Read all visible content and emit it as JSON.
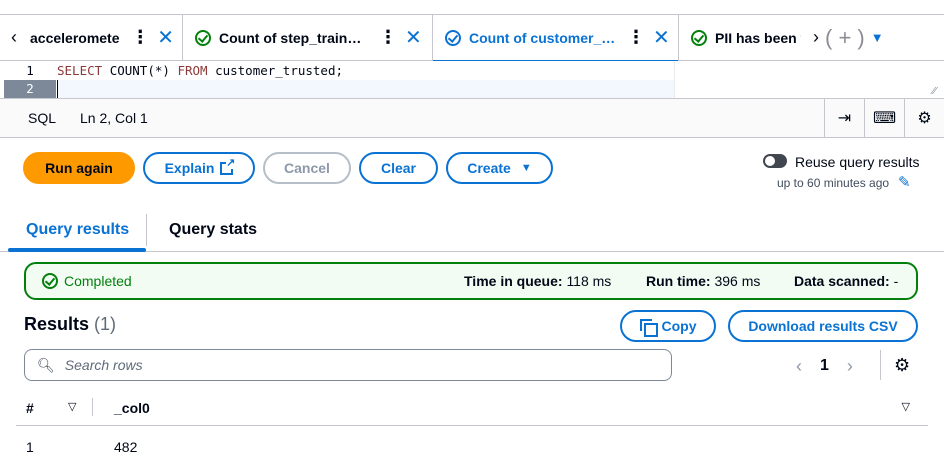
{
  "tabs": [
    {
      "label": "acceleromete",
      "status": "none",
      "active": false
    },
    {
      "label": "Count of step_trainer_trusted",
      "status": "completed",
      "active": false
    },
    {
      "label": "Count of customer_trusted",
      "status": "completed",
      "active": true
    },
    {
      "label": "PII has been filtered",
      "status": "completed",
      "active": false
    }
  ],
  "editor": {
    "line_numbers": [
      "1",
      "2"
    ],
    "line1": {
      "kw1": "SELECT",
      "fn": "COUNT",
      "args": "(*)",
      "kw2": "FROM",
      "rest": "customer_trusted;"
    }
  },
  "statusbar": {
    "language": "SQL",
    "cursor": "Ln 2, Col 1"
  },
  "actions": {
    "run_again": "Run again",
    "explain": "Explain",
    "cancel": "Cancel",
    "clear": "Clear",
    "create": "Create",
    "reuse_label": "Reuse query results",
    "reuse_sub": "up to 60 minutes ago"
  },
  "result_tabs": {
    "results": "Query results",
    "stats": "Query stats"
  },
  "status": {
    "label": "Completed",
    "time_in_queue_label": "Time in queue:",
    "time_in_queue": "118 ms",
    "run_time_label": "Run time:",
    "run_time": "396 ms",
    "data_scanned_label": "Data scanned:",
    "data_scanned": "-"
  },
  "results": {
    "title": "Results",
    "count": "(1)",
    "copy": "Copy",
    "download": "Download results CSV",
    "search_placeholder": "Search rows",
    "page": "1"
  },
  "table": {
    "headers": {
      "index": "#",
      "col0": "_col0"
    },
    "rows": [
      {
        "index": "1",
        "col0": "482"
      }
    ]
  },
  "colors": {
    "accent": "#0972d3",
    "primary": "#ff9900",
    "success": "#037f0c"
  }
}
